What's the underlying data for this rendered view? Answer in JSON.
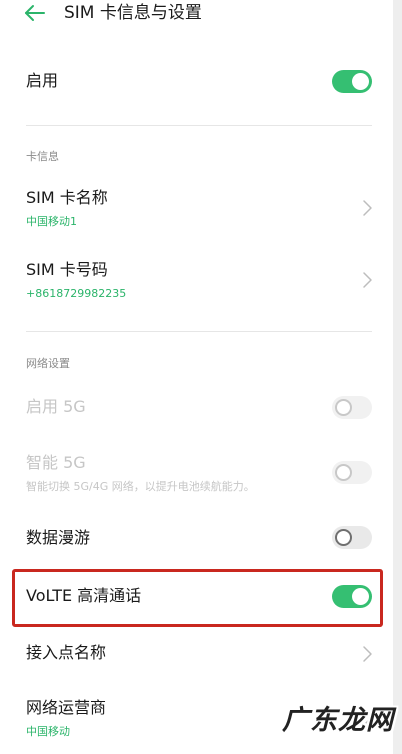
{
  "header": {
    "title": "SIM 卡信息与设置",
    "back_icon": "arrow-left-icon"
  },
  "colors": {
    "accent": "#35bf72",
    "subtext_green": "#2bb46a",
    "highlight_red": "#c9281f",
    "disabled_text": "#c6c6c6"
  },
  "enable_row": {
    "label": "启用",
    "toggle_on": true
  },
  "card_info": {
    "section_label": "卡信息",
    "sim_name": {
      "label": "SIM 卡名称",
      "value": "中国移动1"
    },
    "sim_number": {
      "label": "SIM 卡号码",
      "value": "+8618729982235"
    }
  },
  "network": {
    "section_label": "网络设置",
    "enable_5g": {
      "label": "启用 5G",
      "toggle_on": false,
      "disabled": true
    },
    "smart_5g": {
      "label": "智能 5G",
      "description": "智能切换 5G/4G 网络，以提升电池续航能力。",
      "toggle_on": false,
      "disabled": true
    },
    "data_roaming": {
      "label": "数据漫游",
      "toggle_on": false
    },
    "volte": {
      "label": "VoLTE 高清通话",
      "toggle_on": true
    },
    "apn": {
      "label": "接入点名称"
    },
    "carrier": {
      "label": "网络运营商",
      "value": "中国移动"
    }
  },
  "watermark": {
    "text": "广东龙网"
  }
}
